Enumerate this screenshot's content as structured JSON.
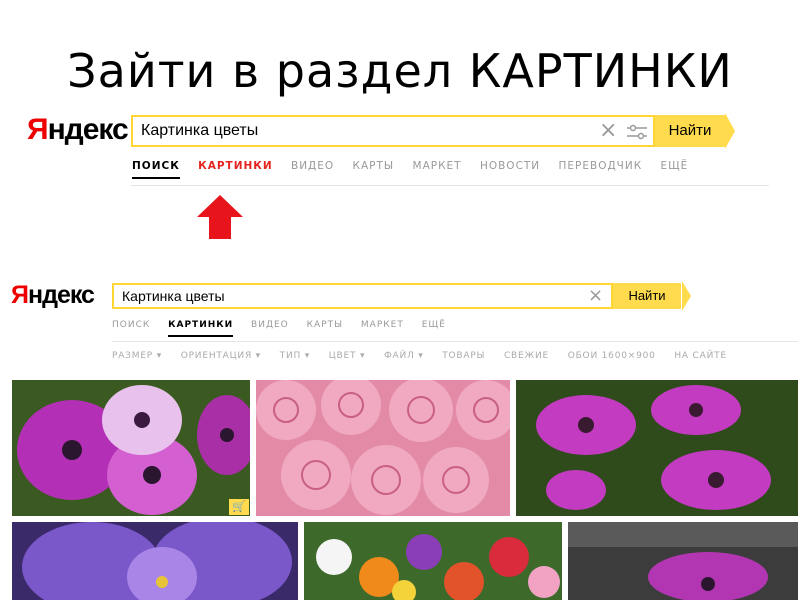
{
  "title": "Зайти в раздел КАРТИНКИ",
  "logo": {
    "first": "Я",
    "rest": "ндекс"
  },
  "search": {
    "query": "Картинка цветы",
    "button": "Найти"
  },
  "top_tabs": [
    "ПОИСК",
    "КАРТИНКИ",
    "ВИДЕО",
    "КАРТЫ",
    "МАРКЕТ",
    "НОВОСТИ",
    "ПЕРЕВОДЧИК",
    "ЕЩЁ"
  ],
  "images_tabs": [
    "ПОИСК",
    "КАРТИНКИ",
    "ВИДЕО",
    "КАРТЫ",
    "МАРКЕТ",
    "ЕЩЁ"
  ],
  "filters": [
    "РАЗМЕР ▾",
    "ОРИЕНТАЦИЯ ▾",
    "ТИП ▾",
    "ЦВЕТ ▾",
    "ФАЙЛ ▾",
    "ТОВАРЫ",
    "СВЕЖИЕ",
    "ОБОИ 1600×900",
    "НА САЙТЕ"
  ],
  "colors": {
    "accent_red": "#e52620",
    "button_yellow": "#ffdb4d",
    "border_yellow": "#ffd633"
  },
  "icons": {
    "clear": "×",
    "settings": "settings-sliders-icon",
    "cart": "🛒"
  }
}
